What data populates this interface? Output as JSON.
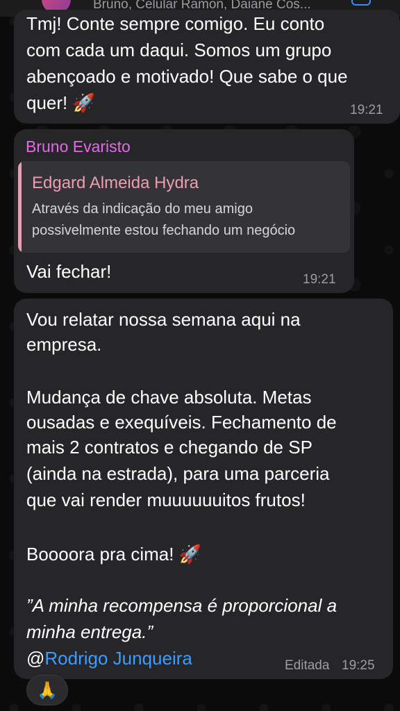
{
  "header": {
    "subtitle": "Bruno, Celular Ramon, Daiane Cos..."
  },
  "messages": [
    {
      "lines": [
        "Tmj! Conte sempre comigo. Eu conto",
        "com cada um daqui. Somos um grupo",
        "abençoado e motivado! Que sabe o que",
        "quer! 🚀"
      ],
      "time": "19:21"
    },
    {
      "sender": "Bruno Evaristo",
      "quote_author": "Edgard Almeida Hydra",
      "quote_lines": [
        "Através da indicação do meu amigo",
        "possivelmente estou fechando um negócio"
      ],
      "text": "Vai fechar!",
      "time": "19:21"
    },
    {
      "lines": [
        "Vou relatar nossa semana aqui na",
        "empresa.",
        "Mudança de chave absoluta. Metas",
        "ousadas e exequíveis. Fechamento de",
        "mais 2 contratos e chegando de SP",
        "(ainda na estrada), para uma parceria",
        "que vai render muuuuuuitos frutos!",
        "Boooora pra cima! 🚀",
        "”A minha recompensa é proporcional a",
        "minha entrega.”",
        "@",
        "Rodrigo Junqueira"
      ],
      "edited_label": "Editada",
      "time": "19:25"
    }
  ],
  "reaction": "🙏"
}
